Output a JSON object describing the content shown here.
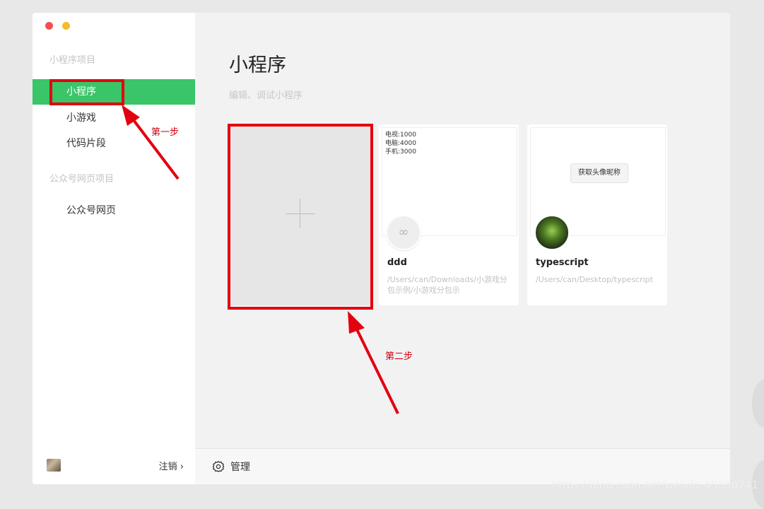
{
  "sidebar": {
    "section_miniprogram": "小程序项目",
    "items": [
      {
        "label": "小程序",
        "active": true
      },
      {
        "label": "小游戏",
        "active": false
      },
      {
        "label": "代码片段",
        "active": false
      }
    ],
    "section_official": "公众号网页项目",
    "official_items": [
      {
        "label": "公众号网页"
      }
    ],
    "logout_label": "注销 ›"
  },
  "main": {
    "title": "小程序",
    "subtitle": "编辑、调试小程序",
    "projects": [
      {
        "name": "ddd",
        "path": "/Users/can/Downloads/小游戏分包示例/小游戏分包示",
        "preview_lines": [
          "电视:1000",
          "电脑:4000",
          "手机:3000"
        ]
      },
      {
        "name": "typescript",
        "path": "/Users/can/Desktop/typescript",
        "preview_button": "获取头像昵称"
      }
    ],
    "manage_label": "管理"
  },
  "annotations": {
    "step1": "第一步",
    "step2": "第二步",
    "color": "#e3000f"
  },
  "watermark": "https://blog.csdn.net/weixin_45330741",
  "colors": {
    "accent": "#3ac569"
  }
}
